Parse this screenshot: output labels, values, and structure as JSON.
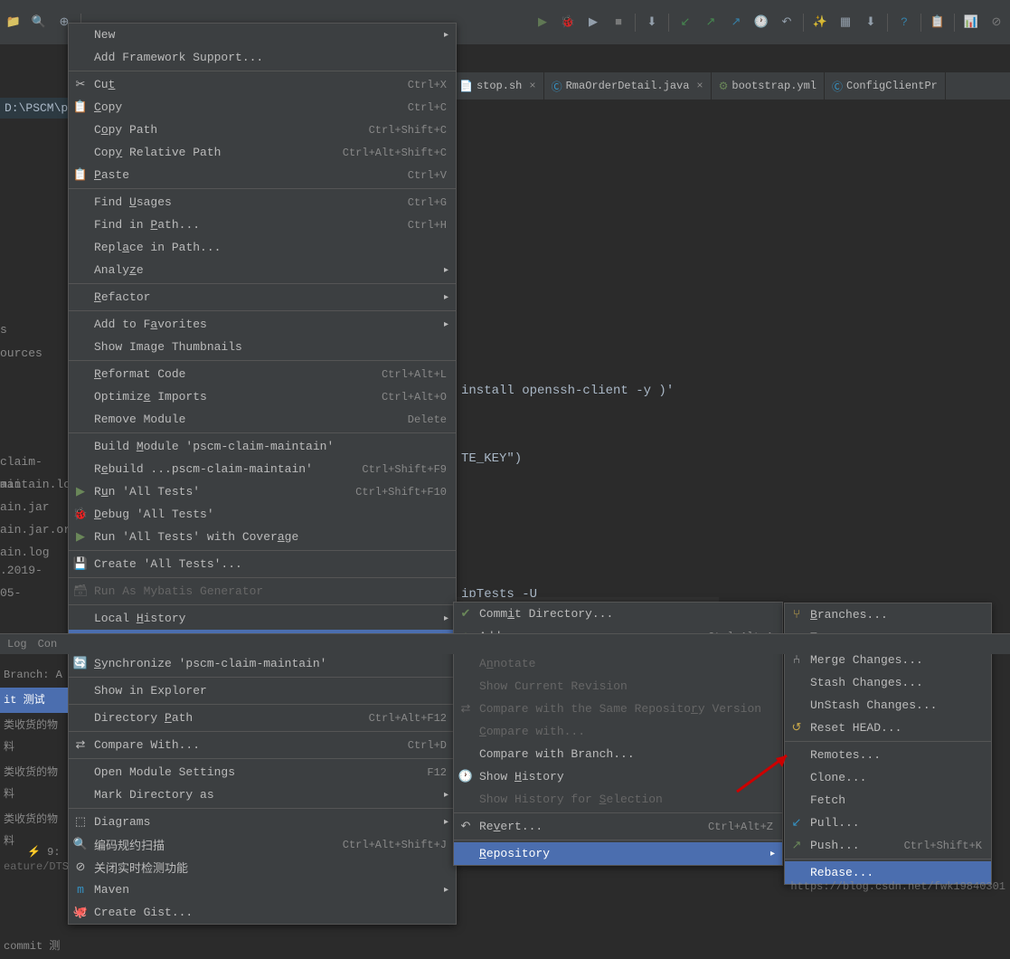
{
  "path_bar": "D:\\PSCM\\p",
  "tabs": [
    {
      "icon": "sh-icon",
      "label": "stop.sh"
    },
    {
      "icon": "java-class-icon",
      "label": "RmaOrderDetail.java"
    },
    {
      "icon": "yaml-icon",
      "label": "bootstrap.yml"
    },
    {
      "icon": "java-class-icon",
      "label": "ConfigClientPr"
    }
  ],
  "editor_lines": {
    "l1": "install openssh-client -y )'",
    "l2": "TE_KEY\")",
    "l3": "ipTests -U",
    "l4": "."
  },
  "sidebar_text": {
    "s1": "s",
    "s2": "ources",
    "claim": "claim-mai",
    "aintain": "aintain.lo",
    "jar1": "ain.jar",
    "jar2": "ain.jar.or",
    "log": "ain.log",
    "date": ".2019-05-"
  },
  "context_menu": [
    {
      "type": "item",
      "label": "New",
      "arrow": true
    },
    {
      "type": "item",
      "label": "Add Framework Support..."
    },
    {
      "type": "sep"
    },
    {
      "type": "item",
      "icon": "cut-icon",
      "label": "Cut",
      "u": 2,
      "shortcut": "Ctrl+X"
    },
    {
      "type": "item",
      "icon": "copy-icon",
      "label": "Copy",
      "u": 0,
      "shortcut": "Ctrl+C"
    },
    {
      "type": "item",
      "label": "Copy Path",
      "u": 1,
      "shortcut": "Ctrl+Shift+C"
    },
    {
      "type": "item",
      "label": "Copy Relative Path",
      "u": 3,
      "shortcut": "Ctrl+Alt+Shift+C"
    },
    {
      "type": "item",
      "icon": "paste-icon",
      "label": "Paste",
      "u": 0,
      "shortcut": "Ctrl+V"
    },
    {
      "type": "sep"
    },
    {
      "type": "item",
      "label": "Find Usages",
      "u": 5,
      "shortcut": "Ctrl+G"
    },
    {
      "type": "item",
      "label": "Find in Path...",
      "u": 8,
      "shortcut": "Ctrl+H"
    },
    {
      "type": "item",
      "label": "Replace in Path...",
      "u": 4
    },
    {
      "type": "item",
      "label": "Analyze",
      "u": 5,
      "arrow": true
    },
    {
      "type": "sep"
    },
    {
      "type": "item",
      "label": "Refactor",
      "u": 0,
      "arrow": true
    },
    {
      "type": "sep"
    },
    {
      "type": "item",
      "label": "Add to Favorites",
      "u": 8,
      "arrow": true
    },
    {
      "type": "item",
      "label": "Show Image Thumbnails"
    },
    {
      "type": "sep"
    },
    {
      "type": "item",
      "label": "Reformat Code",
      "u": 0,
      "shortcut": "Ctrl+Alt+L"
    },
    {
      "type": "item",
      "label": "Optimize Imports",
      "u": 7,
      "shortcut": "Ctrl+Alt+O"
    },
    {
      "type": "item",
      "label": "Remove Module",
      "shortcut": "Delete"
    },
    {
      "type": "sep"
    },
    {
      "type": "item",
      "label": "Build Module 'pscm-claim-maintain'",
      "u": 6
    },
    {
      "type": "item",
      "label": "Rebuild ...pscm-claim-maintain'",
      "u": 1,
      "shortcut": "Ctrl+Shift+F9"
    },
    {
      "type": "item",
      "icon": "run-icon",
      "label": "Run 'All Tests'",
      "u": 1,
      "shortcut": "Ctrl+Shift+F10"
    },
    {
      "type": "item",
      "icon": "debug-icon",
      "label": "Debug 'All Tests'",
      "u": 0
    },
    {
      "type": "item",
      "icon": "coverage-icon",
      "label": "Run 'All Tests' with Coverage",
      "u": 26
    },
    {
      "type": "sep"
    },
    {
      "type": "item",
      "icon": "save-icon",
      "label": "Create 'All Tests'..."
    },
    {
      "type": "sep"
    },
    {
      "type": "item",
      "icon": "db-icon",
      "label": "Run As Mybatis Generator",
      "disabled": true
    },
    {
      "type": "sep"
    },
    {
      "type": "item",
      "label": "Local History",
      "u": 6,
      "arrow": true
    },
    {
      "type": "item",
      "label": "Git",
      "u": 0,
      "arrow": true,
      "highlight": true
    },
    {
      "type": "item",
      "icon": "sync-icon",
      "label": "Synchronize 'pscm-claim-maintain'",
      "u": 0
    },
    {
      "type": "sep"
    },
    {
      "type": "item",
      "label": "Show in Explorer"
    },
    {
      "type": "sep"
    },
    {
      "type": "item",
      "label": "Directory Path",
      "u": 10,
      "shortcut": "Ctrl+Alt+F12"
    },
    {
      "type": "sep"
    },
    {
      "type": "item",
      "icon": "compare-icon",
      "label": "Compare With...",
      "shortcut": "Ctrl+D"
    },
    {
      "type": "sep"
    },
    {
      "type": "item",
      "label": "Open Module Settings",
      "shortcut": "F12"
    },
    {
      "type": "item",
      "label": "Mark Directory as",
      "arrow": true
    },
    {
      "type": "sep"
    },
    {
      "type": "item",
      "icon": "diagram-icon",
      "label": "Diagrams",
      "arrow": true
    },
    {
      "type": "item",
      "icon": "scan-icon",
      "label": "编码规约扫描",
      "shortcut": "Ctrl+Alt+Shift+J"
    },
    {
      "type": "item",
      "icon": "realtime-icon",
      "label": "关闭实时检测功能"
    },
    {
      "type": "item",
      "icon": "maven-icon",
      "label": "Maven",
      "arrow": true
    },
    {
      "type": "item",
      "icon": "github-icon",
      "label": "Create Gist..."
    }
  ],
  "git_submenu": [
    {
      "type": "item",
      "icon": "commit-icon",
      "label": "Commit Directory...",
      "u": 4
    },
    {
      "type": "item",
      "icon": "add-icon",
      "label": "Add",
      "shortcut": "Ctrl+Alt+A"
    },
    {
      "type": "sep"
    },
    {
      "type": "item",
      "label": "Annotate",
      "u": 1,
      "disabled": true
    },
    {
      "type": "item",
      "label": "Show Current Revision",
      "disabled": true
    },
    {
      "type": "item",
      "icon": "compare-repo-icon",
      "label": "Compare with the Same Repository Version",
      "u": 30,
      "disabled": true
    },
    {
      "type": "item",
      "label": "Compare with...",
      "u": 0,
      "disabled": true
    },
    {
      "type": "item",
      "label": "Compare with Branch..."
    },
    {
      "type": "item",
      "icon": "history-icon",
      "label": "Show History",
      "u": 5
    },
    {
      "type": "item",
      "label": "Show History for Selection",
      "u": 17,
      "disabled": true
    },
    {
      "type": "sep"
    },
    {
      "type": "item",
      "icon": "revert-icon",
      "label": "Revert...",
      "u": 2,
      "shortcut": "Ctrl+Alt+Z"
    },
    {
      "type": "sep"
    },
    {
      "type": "item",
      "label": "Repository",
      "u": 0,
      "arrow": true,
      "highlight": true
    }
  ],
  "repo_submenu": [
    {
      "type": "item",
      "icon": "branches-icon",
      "label": "Branches...",
      "u": 0
    },
    {
      "type": "item",
      "label": "Tag..."
    },
    {
      "type": "item",
      "icon": "merge-icon",
      "label": "Merge Changes..."
    },
    {
      "type": "item",
      "label": "Stash Changes..."
    },
    {
      "type": "item",
      "label": "UnStash Changes..."
    },
    {
      "type": "item",
      "icon": "reset-icon",
      "label": "Reset HEAD..."
    },
    {
      "type": "sep"
    },
    {
      "type": "item",
      "label": "Remotes..."
    },
    {
      "type": "item",
      "label": "Clone..."
    },
    {
      "type": "item",
      "label": "Fetch"
    },
    {
      "type": "item",
      "icon": "pull-icon",
      "label": "Pull..."
    },
    {
      "type": "item",
      "icon": "push-icon",
      "label": "Push...",
      "shortcut": "Ctrl+Shift+K"
    },
    {
      "type": "sep"
    },
    {
      "type": "item",
      "label": "Rebase...",
      "highlight": true
    }
  ],
  "bottom_tabs": {
    "log": "Log",
    "con": "Con"
  },
  "branch_area": {
    "branch": "Branch: A",
    "test": "it 测试",
    "row": "类收货的物料",
    "feature": "eature/DTS",
    "commit": "commit 测"
  },
  "status_bar": {
    "left": "9:"
  },
  "watermark": "https://blog.csdn.net/fwk19840301"
}
